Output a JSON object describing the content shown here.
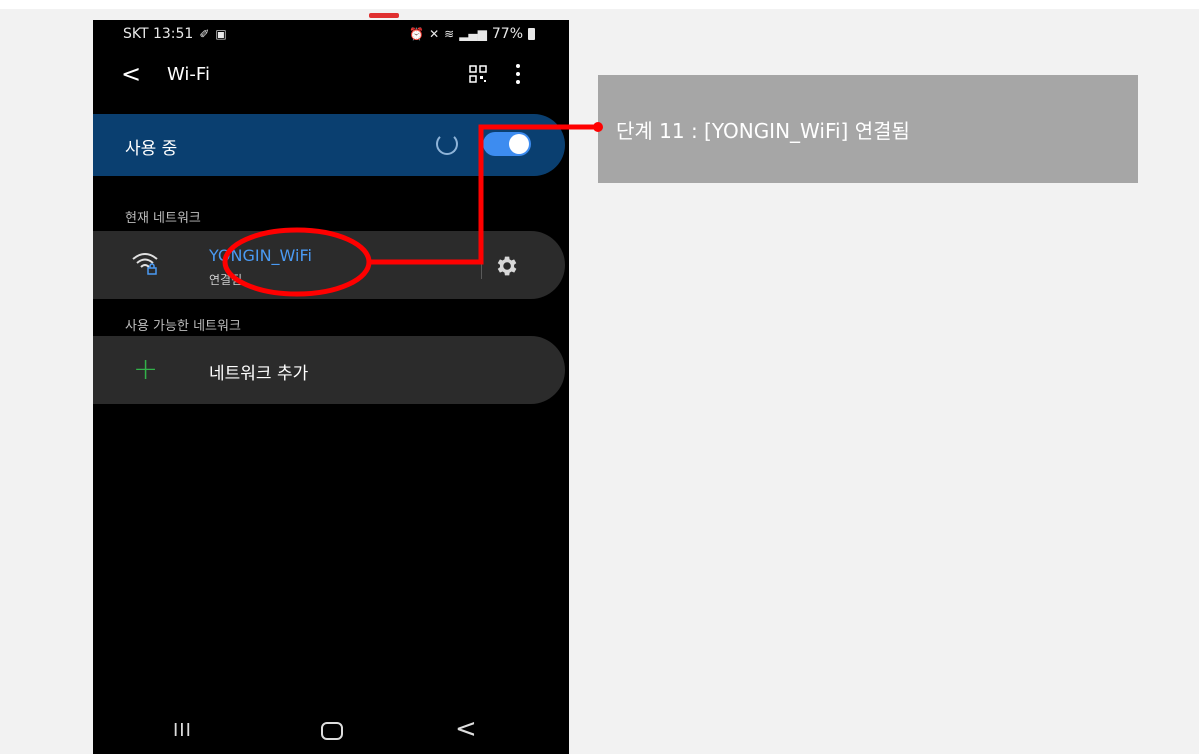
{
  "status_bar": {
    "carrier_time": "SKT 13:51",
    "battery": "77%"
  },
  "appbar": {
    "title": "Wi-Fi"
  },
  "wifi_toggle": {
    "label": "사용 중",
    "enabled": true
  },
  "current_network": {
    "section_label": "현재 네트워크",
    "name": "YONGIN_WiFi",
    "status": "연결됨"
  },
  "available_networks": {
    "section_label": "사용 가능한 네트워크",
    "add_label": "네트워크 추가"
  },
  "annotation": {
    "text": "단계 11 : [YONGIN_WiFi] 연결됨"
  },
  "colors": {
    "accent_blue": "#4a9af3",
    "toggle_card": "#0a3f70",
    "highlight_red": "#ff0000",
    "add_green": "#33b24a"
  },
  "icons": [
    "back-arrow-icon",
    "qr-code-icon",
    "more-vert-icon",
    "wifi-lock-icon",
    "gear-icon",
    "plus-icon",
    "recent-apps-icon",
    "home-icon",
    "nav-back-icon"
  ]
}
